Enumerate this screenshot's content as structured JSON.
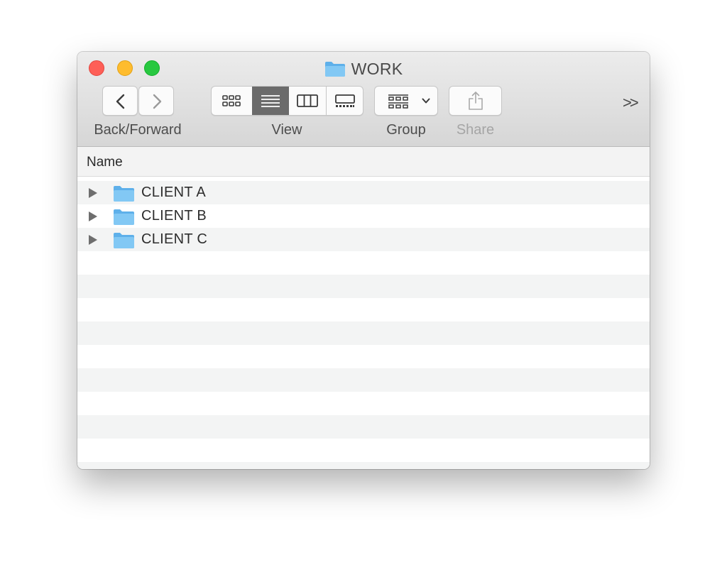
{
  "window": {
    "title": "WORK",
    "title_icon": "folder-icon"
  },
  "toolbar": {
    "back_forward_label": "Back/Forward",
    "view_label": "View",
    "group_label": "Group",
    "share_label": "Share",
    "view_modes": [
      "icons",
      "list",
      "columns",
      "gallery"
    ],
    "active_view": "list",
    "overflow_glyph": ">>"
  },
  "header": {
    "name_column": "Name"
  },
  "items": [
    {
      "name": "CLIENT A",
      "kind": "folder"
    },
    {
      "name": "CLIENT B",
      "kind": "folder"
    },
    {
      "name": "CLIENT C",
      "kind": "folder"
    }
  ],
  "colors": {
    "folder": "#7ac4f2",
    "close": "#fe5f57",
    "minimize": "#febc2e",
    "maximize": "#28c840",
    "row_stripe": "#f3f4f4"
  }
}
